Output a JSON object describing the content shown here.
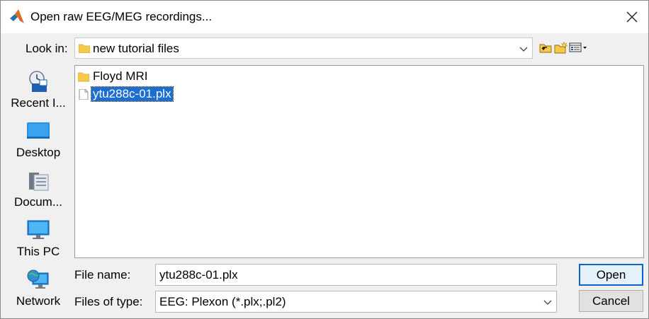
{
  "window": {
    "title": "Open raw EEG/MEG recordings..."
  },
  "lookin": {
    "label": "Look in:",
    "value": "new tutorial files"
  },
  "places": [
    {
      "label": "Recent I...",
      "icon": "recent-items-icon"
    },
    {
      "label": "Desktop",
      "icon": "desktop-icon"
    },
    {
      "label": "Docum...",
      "icon": "documents-icon"
    },
    {
      "label": "This PC",
      "icon": "this-pc-icon"
    },
    {
      "label": "Network",
      "icon": "network-icon"
    }
  ],
  "files": [
    {
      "name": "Floyd MRI",
      "type": "folder",
      "selected": false
    },
    {
      "name": "ytu288c-01.plx",
      "type": "file",
      "selected": true
    }
  ],
  "form": {
    "filename_label": "File name:",
    "filename_value": "ytu288c-01.plx",
    "filetype_label": "Files of type:",
    "filetype_value": "EEG: Plexon (*.plx;.pl2)"
  },
  "buttons": {
    "open": "Open",
    "cancel": "Cancel"
  },
  "colors": {
    "selection": "#1c6fd1",
    "folder": "#f7c948",
    "accent": "#0a64c9"
  }
}
